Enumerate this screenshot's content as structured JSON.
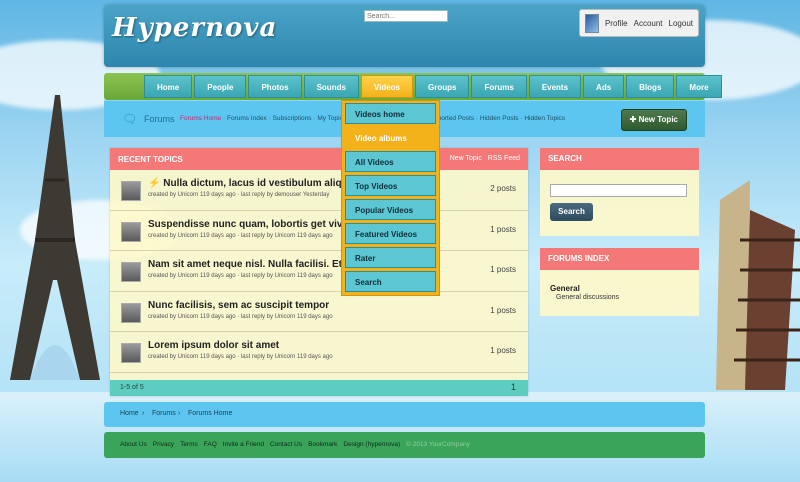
{
  "header": {
    "logo": "Hypernova",
    "search_placeholder": "Search...",
    "user_links": [
      "Profile",
      "Account",
      "Logout"
    ]
  },
  "nav": {
    "items": [
      "Home",
      "People",
      "Photos",
      "Sounds",
      "Videos",
      "Groups",
      "Forums",
      "Events",
      "Ads",
      "Blogs",
      "More"
    ],
    "active": "Videos"
  },
  "videos_menu": {
    "items": [
      "Videos home",
      "Video albums",
      "All Videos",
      "Top Videos",
      "Popular Videos",
      "Featured Videos",
      "Rater",
      "Search"
    ],
    "highlighted": "Video albums"
  },
  "forum_bar": {
    "title": "Forums",
    "links": [
      "Forums Home",
      "Forums Index",
      "Subscriptions",
      "My Topics"
    ],
    "links_right": [
      "eported Posts",
      "Hidden Posts",
      "Hidden Topics"
    ],
    "new_topic_label": "New Topic"
  },
  "recent_topics": {
    "header": "RECENT TOPICS",
    "header_links": [
      "New Topic",
      "RSS Feed"
    ],
    "rows": [
      {
        "title": "Nulla dictum, lacus id vestibulum aliquet",
        "meta": "created by Unicorn 119 days ago · last reply by demouser Yesterday",
        "posts": "2 posts",
        "hot": true
      },
      {
        "title": "Suspendisse nunc quam, lobortis get vive",
        "meta": "created by Unicorn 119 days ago · last reply by Unicorn 119 days ago",
        "posts": "1 posts",
        "hot": false
      },
      {
        "title": "Nam sit amet neque nisl. Nulla facilisi. Etia",
        "meta": "created by Unicorn 119 days ago · last reply by Unicorn 119 days ago",
        "posts": "1 posts",
        "hot": false
      },
      {
        "title": "Nunc facilisis, sem ac suscipit tempor",
        "meta": "created by Unicorn 119 days ago · last reply by Unicorn 119 days ago",
        "posts": "1 posts",
        "hot": false
      },
      {
        "title": "Lorem ipsum dolor sit amet",
        "meta": "created by Unicorn 119 days ago · last reply by Unicorn 119 days ago",
        "posts": "1 posts",
        "hot": false
      }
    ],
    "pager_text": "1-5 of 5",
    "page": "1"
  },
  "sidebar": {
    "search_header": "SEARCH",
    "search_button": "Search",
    "forums_index_header": "FORUMS INDEX",
    "group": "General",
    "subforum": "General discussions"
  },
  "breadcrumb": [
    "Home",
    "Forums",
    "Forums Home"
  ],
  "footer": {
    "links": [
      "About Us",
      "Privacy",
      "Terms",
      "FAQ",
      "Invite a Friend",
      "Contact Us",
      "Bookmark",
      "Design (hypernova)"
    ],
    "copyright": "© 2013 YourCompany"
  },
  "colors": {
    "nav_green": "#8dc34f",
    "tab_teal": "#3aa7b2",
    "active_yellow": "#f3b21a",
    "panel_header_red": "#f47878",
    "footer_green": "#3aa45a"
  }
}
